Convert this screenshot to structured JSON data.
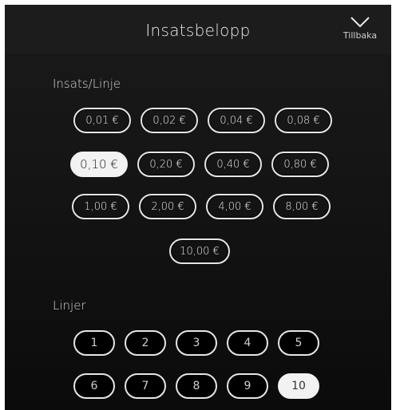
{
  "header": {
    "title": "Insatsbelopp",
    "back_label": "Tillbaka",
    "back_icon": "chevron-down-icon"
  },
  "bet_section": {
    "label": "Insats/Linje",
    "selected": "0,10 €",
    "rows": [
      [
        "0,01 €",
        "0,02 €",
        "0,04 €",
        "0,08 €"
      ],
      [
        "0,10 €",
        "0,20 €",
        "0,40 €",
        "0,80 €"
      ],
      [
        "1,00 €",
        "2,00 €",
        "4,00 €",
        "8,00 €"
      ],
      [
        "10,00 €"
      ]
    ]
  },
  "lines_section": {
    "label": "Linjer",
    "selected": "10",
    "rows": [
      [
        "1",
        "2",
        "3",
        "4",
        "5"
      ],
      [
        "6",
        "7",
        "8",
        "9",
        "10"
      ]
    ]
  },
  "colors": {
    "background": "#151515",
    "header": "#1c1c1c",
    "outline": "#e6e6e6",
    "selected_fill": "#f2f2f2"
  }
}
